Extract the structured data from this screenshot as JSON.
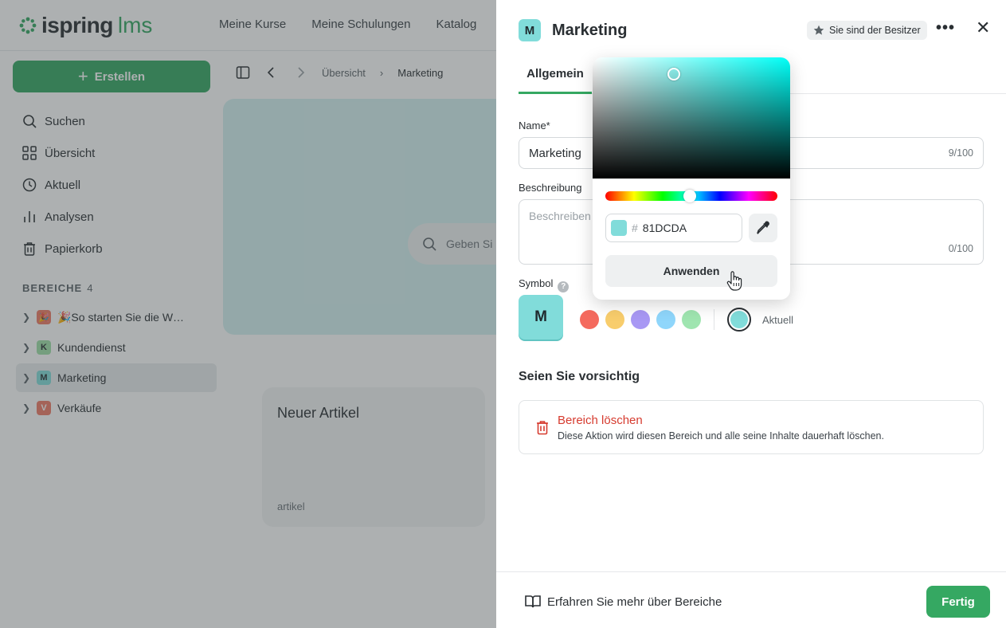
{
  "app": {
    "logo_name": "ispring",
    "logo_suffix": "lms",
    "topnav": [
      "Meine Kurse",
      "Meine Schulungen",
      "Katalog"
    ]
  },
  "sidebar": {
    "create_label": "Erstellen",
    "nav": [
      {
        "label": "Suchen",
        "icon": "search-icon"
      },
      {
        "label": "Übersicht",
        "icon": "grid-icon"
      },
      {
        "label": "Aktuell",
        "icon": "clock-icon"
      },
      {
        "label": "Analysen",
        "icon": "bar-chart-icon"
      },
      {
        "label": "Papierkorb",
        "icon": "trash-icon"
      }
    ],
    "section_title": "BEREICHE",
    "section_count": "4",
    "areas": [
      {
        "badge": "🎉",
        "label": "🎉So starten Sie die W…",
        "color": "#f07a66"
      },
      {
        "badge": "K",
        "label": "Kundendienst",
        "color": "#9fe0a8"
      },
      {
        "badge": "M",
        "label": "Marketing",
        "color": "#81dcda"
      },
      {
        "badge": "V",
        "label": "Verkäufe",
        "color": "#f07a66"
      }
    ]
  },
  "content": {
    "breadcrumb_root": "Übersicht",
    "breadcrumb_current": "Marketing",
    "search_placeholder": "Geben Si",
    "card_title": "Neuer Artikel",
    "card_sub": "artikel"
  },
  "drawer": {
    "badge": "M",
    "title": "Marketing",
    "owner_label": "Sie sind der Besitzer",
    "tab_general": "Allgemein",
    "name_label": "Name*",
    "name_value": "Marketing",
    "name_counter": "9/100",
    "desc_label": "Beschreibung",
    "desc_placeholder": "Beschreiben",
    "desc_counter": "0/100",
    "symbol_label": "Symbol",
    "symbol_letter": "M",
    "swatches": [
      "#f46a5e",
      "#f8cd6c",
      "#a898f4",
      "#8fd6fb",
      "#9fe5b0"
    ],
    "current_color": "#81DCDA",
    "current_label": "Aktuell",
    "warning_title": "Seien Sie vorsichtig",
    "delete_title": "Bereich löschen",
    "delete_sub": "Diese Aktion wird diesen Bereich und alle seine Inhalte dauerhaft löschen.",
    "learn_more": "Erfahren Sie mehr über Bereiche",
    "done_label": "Fertig"
  },
  "picker": {
    "hex_value": "81DCDA",
    "apply_label": "Anwenden"
  },
  "colors": {
    "accent": "#35a862",
    "danger": "#d63b2f"
  }
}
